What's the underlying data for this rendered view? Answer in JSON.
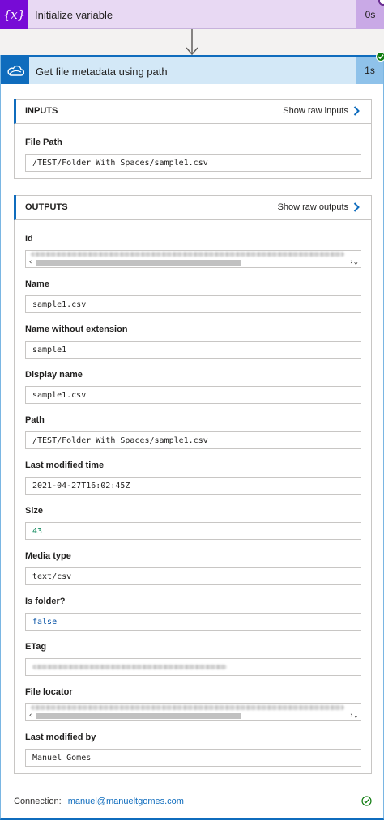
{
  "init_variable": {
    "title": "Initialize variable",
    "icon_glyph": "{x}",
    "icon": "variable-braces-icon",
    "duration": "0s",
    "accent_color": "#770bd6"
  },
  "get_metadata": {
    "title": "Get file metadata using path",
    "icon": "onedrive-cloud-icon",
    "duration": "1s",
    "accent_color": "#0f6cbd",
    "status_color": "#107c10"
  },
  "inputs": {
    "title": "INPUTS",
    "raw_label": "Show raw inputs",
    "fields": {
      "file_path": {
        "label": "File Path",
        "value": "/TEST/Folder With Spaces/sample1.csv"
      }
    }
  },
  "outputs": {
    "title": "OUTPUTS",
    "raw_label": "Show raw outputs",
    "fields": {
      "id": {
        "label": "Id"
      },
      "name": {
        "label": "Name",
        "value": "sample1.csv"
      },
      "name_no_ext": {
        "label": "Name without extension",
        "value": "sample1"
      },
      "display_name": {
        "label": "Display name",
        "value": "sample1.csv"
      },
      "path": {
        "label": "Path",
        "value": "/TEST/Folder With Spaces/sample1.csv"
      },
      "last_modified": {
        "label": "Last modified time",
        "value": "2021-04-27T16:02:45Z"
      },
      "size": {
        "label": "Size",
        "value": "43"
      },
      "media_type": {
        "label": "Media type",
        "value": "text/csv"
      },
      "is_folder": {
        "label": "Is folder?",
        "value": "false"
      },
      "etag": {
        "label": "ETag"
      },
      "file_locator": {
        "label": "File locator"
      },
      "last_modified_by": {
        "label": "Last modified by",
        "value": "Manuel Gomes"
      }
    }
  },
  "footer": {
    "connection_label": "Connection:",
    "connection_value": "manuel@manueltgomes.com"
  }
}
